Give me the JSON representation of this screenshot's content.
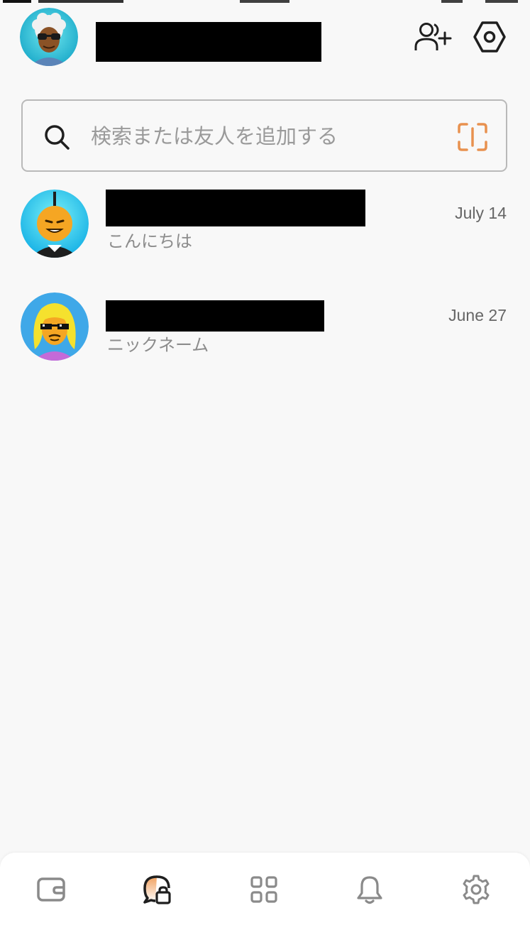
{
  "header": {
    "profile_avatar_icon": "user-avatar",
    "add_friend_icon": "add-person-icon",
    "target_icon": "hexagon-target-icon"
  },
  "search": {
    "placeholder": "検索または友人を追加する",
    "value": "",
    "qr_icon": "qr-scan-icon"
  },
  "conversations": [
    {
      "preview": "こんにちは",
      "date": "July 14"
    },
    {
      "preview": "ニックネーム",
      "date": "June 27"
    }
  ],
  "tabbar": {
    "tabs": [
      {
        "icon": "wallet-icon"
      },
      {
        "icon": "chat-lock-icon",
        "active": true
      },
      {
        "icon": "apps-grid-icon"
      },
      {
        "icon": "bell-icon"
      },
      {
        "icon": "gear-icon"
      }
    ]
  },
  "colors": {
    "background": "#f8f8f8",
    "accent_orange": "#e8914f",
    "icon_dark": "#1f1f1f",
    "icon_gray": "#8a8a8a",
    "redaction": "#000000"
  }
}
